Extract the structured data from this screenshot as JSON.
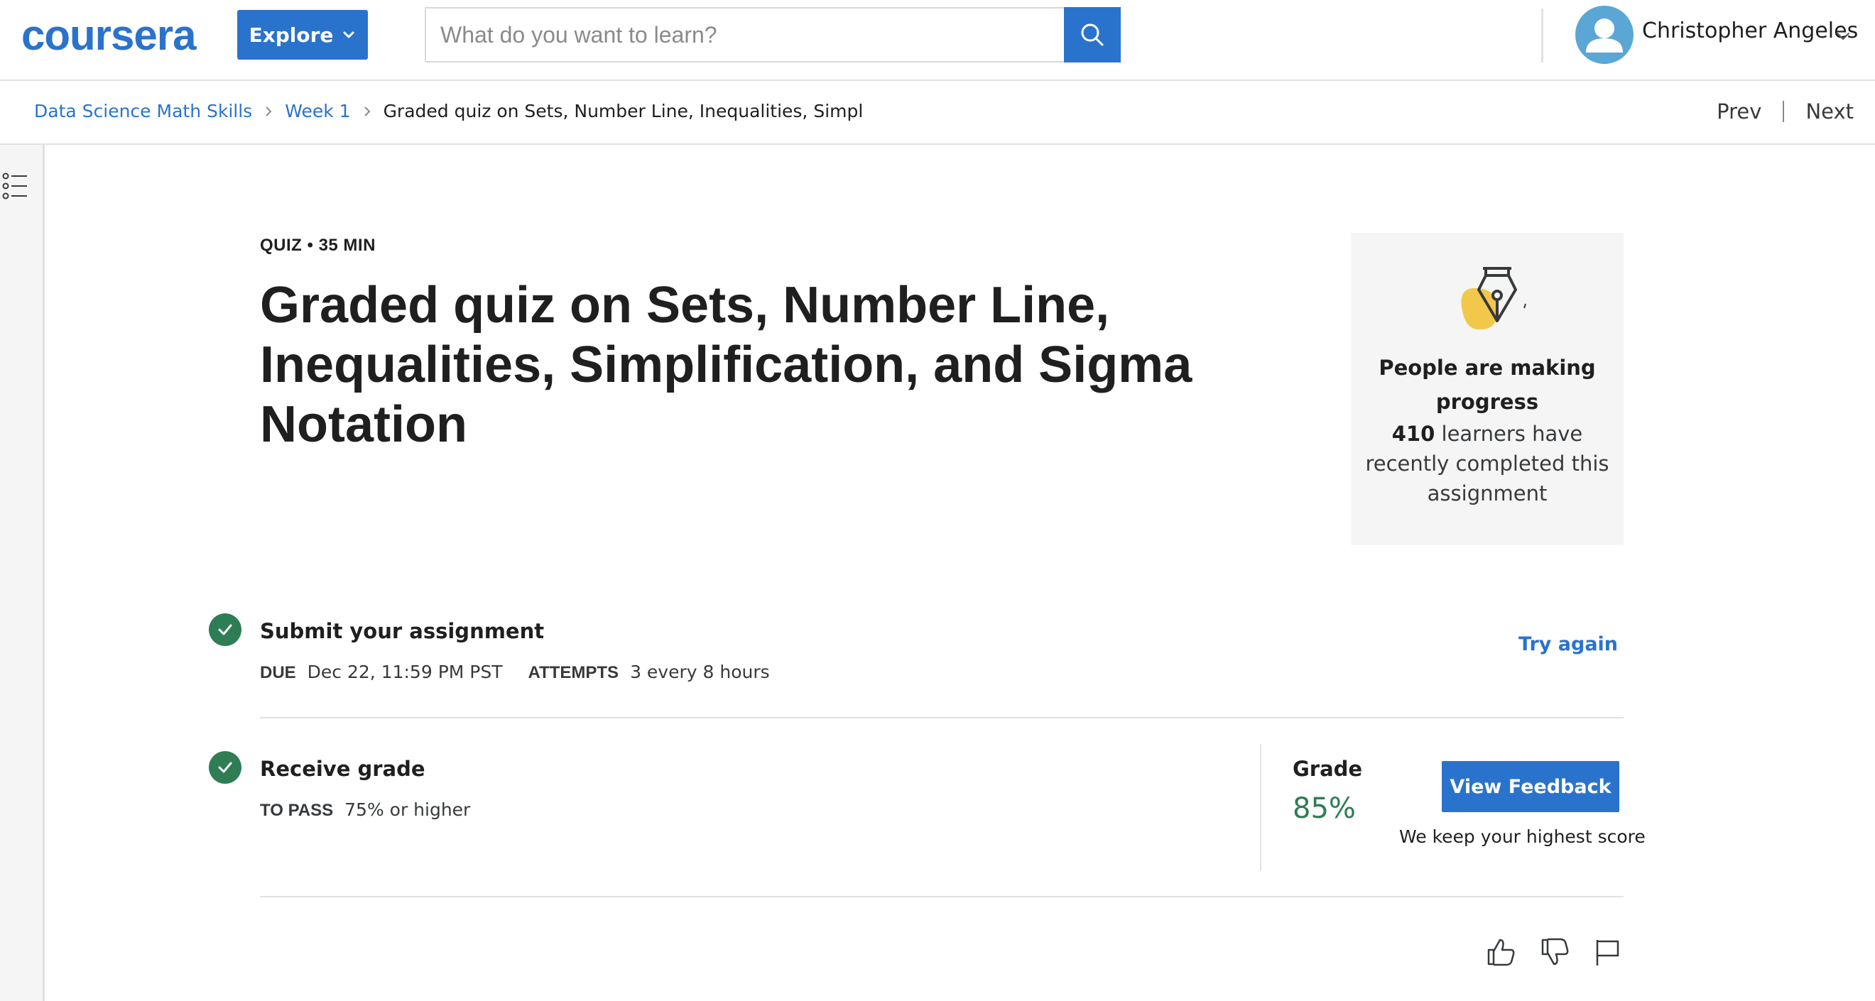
{
  "header": {
    "logo_text": "coursera",
    "explore_label": "Explore",
    "search_placeholder": "What do you want to learn?",
    "user_name": "Christopher Angeles"
  },
  "breadcrumb": {
    "items": [
      "Data Science Math Skills",
      "Week 1",
      "Graded quiz on Sets, Number Line, Inequalities, Simpl"
    ],
    "prev_label": "Prev",
    "next_label": "Next"
  },
  "quiz": {
    "meta": "QUIZ • 35 MIN",
    "title": "Graded quiz on Sets, Number Line, Inequalities, Simplification, and Sigma Notation"
  },
  "progress_card": {
    "title": "People are making progress",
    "count": "410",
    "text": " learners have recently completed this assignment"
  },
  "submit_step": {
    "title": "Submit your assignment",
    "due_key": "DUE",
    "due_value": "Dec 22, 11:59 PM PST",
    "attempts_key": "ATTEMPTS",
    "attempts_value": "3 every 8 hours",
    "try_again_label": "Try again"
  },
  "grade_step": {
    "title": "Receive grade",
    "pass_key": "TO PASS",
    "pass_value": "75% or higher",
    "grade_label": "Grade",
    "grade_value": "85%",
    "feedback_button": "View Feedback",
    "note": "We keep your highest score"
  },
  "colors": {
    "brand_blue": "#2a73cc",
    "success_green": "#2e7d55",
    "card_bg": "#f5f5f5",
    "pen_accent_yellow": "#f2c84b"
  },
  "icons": [
    "chevron-down-icon",
    "search-icon",
    "avatar-icon",
    "chevron-right-icon",
    "list-icon",
    "pen-icon",
    "checkmark-icon",
    "thumbs-up-icon",
    "thumbs-down-icon",
    "flag-icon"
  ]
}
